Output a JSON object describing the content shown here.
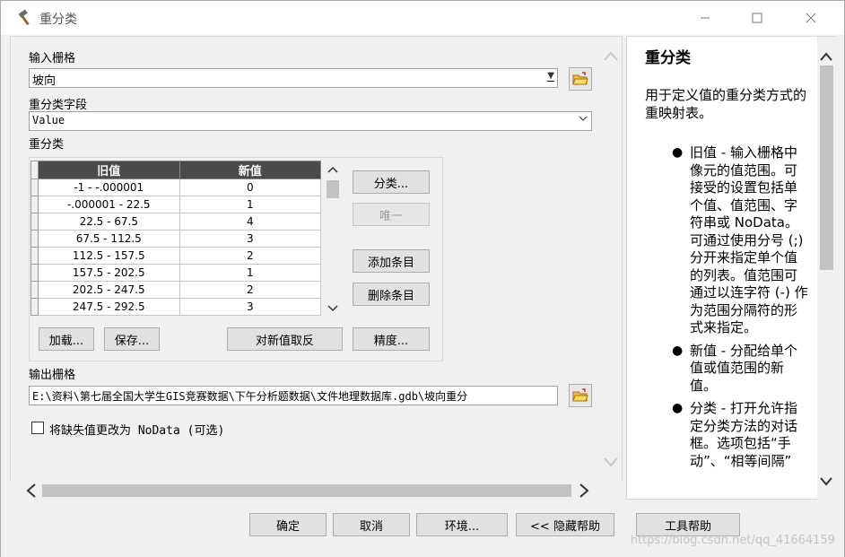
{
  "window": {
    "title": "重分类"
  },
  "form": {
    "input_raster_label": "输入栅格",
    "input_raster_value": "坡向",
    "reclass_field_label": "重分类字段",
    "reclass_field_value": "Value",
    "reclass_label": "重分类",
    "table": {
      "headers": [
        "旧值",
        "新值"
      ],
      "rows": [
        [
          "-1 - -.000001",
          "0"
        ],
        [
          "-.000001 - 22.5",
          "1"
        ],
        [
          "22.5 - 67.5",
          "4"
        ],
        [
          "67.5 - 112.5",
          "3"
        ],
        [
          "112.5 - 157.5",
          "2"
        ],
        [
          "157.5 - 202.5",
          "1"
        ],
        [
          "202.5 - 247.5",
          "2"
        ],
        [
          "247.5 - 292.5",
          "3"
        ]
      ]
    },
    "buttons": {
      "classify": "分类...",
      "unique": "唯一",
      "add_entry": "添加条目",
      "delete_entry": "删除条目",
      "load": "加载...",
      "save": "保存...",
      "reverse": "对新值取反",
      "precision": "精度..."
    },
    "output_raster_label": "输出栅格",
    "output_raster_value": "E:\\资料\\第七届全国大学生GIS竞赛数据\\下午分析题数据\\文件地理数据库.gdb\\坡向重分",
    "nodata_checkbox_label": "将缺失值更改为 NoData (可选)"
  },
  "help": {
    "title": "重分类",
    "intro": "用于定义值的重分类方式的重映射表。",
    "items": [
      "旧值 - 输入栅格中像元的值范围。可接受的设置包括单个值、值范围、字符串或 NoData。可通过使用分号 (;) 分开来指定单个值的列表。值范围可通过以连字符 (-) 作为范围分隔符的形式来指定。",
      "新值 - 分配给单个值或值范围的新值。",
      "分类 - 打开允许指定分类方法的对话框。选项包括“手动”、“相等间隔”"
    ]
  },
  "footer": {
    "ok": "确定",
    "cancel": "取消",
    "environments": "环境...",
    "hide_help": "<< 隐藏帮助",
    "tool_help": "工具帮助",
    "watermark": "https://blog.csdn.net/qq_41664159"
  }
}
